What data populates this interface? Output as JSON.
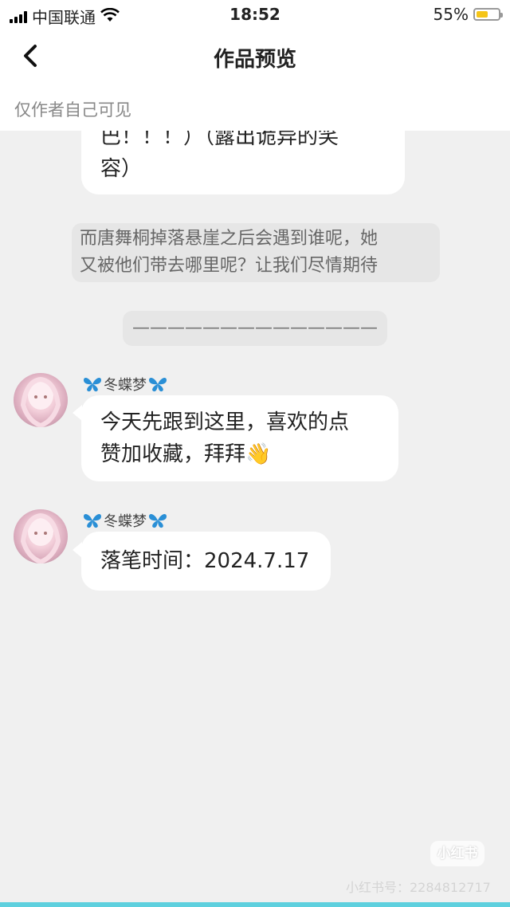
{
  "status_bar": {
    "carrier": "中国联通",
    "time": "18:52",
    "battery_percent": "55%",
    "battery_level": 0.55,
    "battery_color": "#f5c518",
    "icons": [
      "signal-icon",
      "wifi-icon",
      "battery-icon"
    ]
  },
  "header": {
    "title": "作品预览",
    "subtitle": "仅作者自己可见",
    "back_icon": "chevron-left-icon"
  },
  "messages": [
    {
      "type": "bubble_partial",
      "line1": "巴！！！）（露出诡异的笑",
      "line2": "容）"
    },
    {
      "type": "narration",
      "line1": "而唐舞桐掉落悬崖之后会遇到谁呢，她",
      "line2": "又被他们带去哪里呢？让我们尽情期待"
    },
    {
      "type": "divider",
      "text": "——————————————"
    },
    {
      "type": "chat",
      "sender": "冬蝶梦",
      "line1": "今天先跟到这里，喜欢的点",
      "line2": "赞加收藏，拜拜👋"
    },
    {
      "type": "chat",
      "sender": "冬蝶梦",
      "line1": "落笔时间：2024.7.17"
    }
  ],
  "watermark": {
    "logo": "小红书",
    "text": "小红书号：2284812717"
  },
  "colors": {
    "background": "#f0f0f0",
    "bubble": "#ffffff",
    "narration_bg": "#e6e6e6",
    "butterfly": "#2a8fd6",
    "accent_bottom": "#5ed0de"
  }
}
